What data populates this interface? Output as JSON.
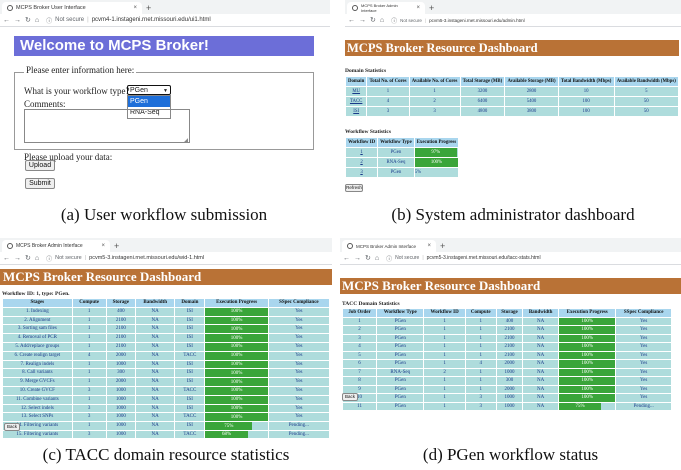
{
  "panel_a": {
    "tab_title": "MCPS Broker User Interface",
    "not_secure": "Not secure",
    "url": "pcvm4-1.instageni.rnet.missouri.edu/ui1.html",
    "heading": "Welcome to MCPS Broker!",
    "legend": "Please enter information here:",
    "workflow_label": "What is your workflow type?",
    "workflow_selected": "PGen",
    "workflow_options": [
      "PGen",
      "RNA-Seq"
    ],
    "comments_label": "Comments:",
    "upload_label": "Please upload your data:",
    "upload_button": "Upload",
    "submit_button": "Submit",
    "caption": "(a) User workflow submission"
  },
  "panel_b": {
    "tab_title": "MCPS Broker Admin Interface",
    "not_secure": "Not secure",
    "url": "pcvm5-3.instageni.rnet.missouri.edu/admin.html",
    "heading": "MCPS Broker Resource Dashboard",
    "domain_title": "Domain Statistics",
    "domain_headers": [
      "Domain",
      "Total No. of Cores",
      "Available No. of Cores",
      "Total Storage (MB)",
      "Available Storage (MB)",
      "Total Bandwidth (Mbps)",
      "Available Bandwidth (Mbps)"
    ],
    "domain_rows": [
      [
        "MU",
        "1",
        "1",
        "3200",
        "2800",
        "10",
        "5"
      ],
      [
        "TACC",
        "4",
        "2",
        "6400",
        "5400",
        "100",
        "50"
      ],
      [
        "ISI",
        "3",
        "3",
        "4800",
        "3800",
        "100",
        "50"
      ]
    ],
    "workflow_title": "Workflow Statistics",
    "workflow_headers": [
      "Workflow ID",
      "Workflow Type",
      "Execution Progress"
    ],
    "workflow_rows": [
      {
        "id": "1",
        "type": "PGen",
        "progress_text": "97%",
        "progress": 0.97
      },
      {
        "id": "2",
        "type": "RNA-Seq",
        "progress_text": "100%",
        "progress": 1.0
      },
      {
        "id": "3",
        "type": "PGen",
        "progress_text": "5%",
        "progress": 0.05
      }
    ],
    "refresh_button": "Refresh",
    "caption": "(b) System administrator dashboard"
  },
  "panel_c": {
    "tab_title": "MCPS Broker Admin Interface",
    "not_secure": "Not secure",
    "url": "pcvm5-3.instageni.rnet.missouri.edu/wid-1.html",
    "heading": "MCPS Broker Resource Dashboard",
    "subtitle": "Workflow ID: 1, type: PGen.",
    "headers": [
      "Stages",
      "Compute",
      "Storage",
      "Bandwidth",
      "Domain",
      "Execution Progress",
      "SSpec Compliance"
    ],
    "rows": [
      {
        "stage": "1. Indexing",
        "compute": "1",
        "storage": "400",
        "bandwidth": "NA",
        "domain": "ISI",
        "progress_text": "100%",
        "progress": 1.0,
        "compliance": "Yes"
      },
      {
        "stage": "2. Alignment",
        "compute": "1",
        "storage": "2100",
        "bandwidth": "NA",
        "domain": "ISI",
        "progress_text": "100%",
        "progress": 1.0,
        "compliance": "Yes"
      },
      {
        "stage": "3. Sorting sam files",
        "compute": "1",
        "storage": "2100",
        "bandwidth": "NA",
        "domain": "ISI",
        "progress_text": "100%",
        "progress": 1.0,
        "compliance": "Yes"
      },
      {
        "stage": "4. Removal of PCR",
        "compute": "1",
        "storage": "2100",
        "bandwidth": "NA",
        "domain": "ISI",
        "progress_text": "100%",
        "progress": 1.0,
        "compliance": "Yes"
      },
      {
        "stage": "5. Add/replace groups",
        "compute": "1",
        "storage": "2100",
        "bandwidth": "NA",
        "domain": "ISI",
        "progress_text": "100%",
        "progress": 1.0,
        "compliance": "Yes"
      },
      {
        "stage": "6. Create realign target",
        "compute": "4",
        "storage": "2000",
        "bandwidth": "NA",
        "domain": "TACC",
        "progress_text": "100%",
        "progress": 1.0,
        "compliance": "Yes"
      },
      {
        "stage": "7. Realign indels",
        "compute": "1",
        "storage": "1000",
        "bandwidth": "NA",
        "domain": "ISI",
        "progress_text": "100%",
        "progress": 1.0,
        "compliance": "Yes"
      },
      {
        "stage": "8. Call variants",
        "compute": "1",
        "storage": "300",
        "bandwidth": "NA",
        "domain": "ISI",
        "progress_text": "100%",
        "progress": 1.0,
        "compliance": "Yes"
      },
      {
        "stage": "9. Merge GVCFs",
        "compute": "1",
        "storage": "2000",
        "bandwidth": "NA",
        "domain": "ISI",
        "progress_text": "100%",
        "progress": 1.0,
        "compliance": "Yes"
      },
      {
        "stage": "10. Create GVCF",
        "compute": "3",
        "storage": "1000",
        "bandwidth": "NA",
        "domain": "TACC",
        "progress_text": "100%",
        "progress": 1.0,
        "compliance": "Yes"
      },
      {
        "stage": "11. Combine variants",
        "compute": "1",
        "storage": "1000",
        "bandwidth": "NA",
        "domain": "ISI",
        "progress_text": "100%",
        "progress": 1.0,
        "compliance": "Yes"
      },
      {
        "stage": "12. Select indels",
        "compute": "3",
        "storage": "1000",
        "bandwidth": "NA",
        "domain": "ISI",
        "progress_text": "100%",
        "progress": 1.0,
        "compliance": "Yes"
      },
      {
        "stage": "13. Select SNPs",
        "compute": "3",
        "storage": "1000",
        "bandwidth": "NA",
        "domain": "TACC",
        "progress_text": "100%",
        "progress": 1.0,
        "compliance": "Yes"
      },
      {
        "stage": "14. Filtering variants",
        "compute": "1",
        "storage": "1000",
        "bandwidth": "NA",
        "domain": "ISI",
        "progress_text": "75%",
        "progress": 0.75,
        "compliance": "Pending..."
      },
      {
        "stage": "15. Filtering variants",
        "compute": "3",
        "storage": "1000",
        "bandwidth": "NA",
        "domain": "TACC",
        "progress_text": "68%",
        "progress": 0.68,
        "compliance": "Pending..."
      }
    ],
    "back_button": "Back",
    "caption": "(c) TACC domain resource statistics"
  },
  "panel_d": {
    "tab_title": "MCPS Broker Admin Interface",
    "not_secure": "Not secure",
    "url": "pcvm5-3.instageni.rnet.missouri.edu/tacc-stats.html",
    "heading": "MCPS Broker Resource Dashboard",
    "subtitle": "TACC Domain Statistics",
    "headers": [
      "Job Order",
      "Workflow Type",
      "Workflow ID",
      "Compute",
      "Storage",
      "Bandwidth",
      "Execution Progress",
      "SSpec Compliance"
    ],
    "rows": [
      {
        "order": "1",
        "type": "PGen",
        "wid": "1",
        "compute": "1",
        "storage": "400",
        "bandwidth": "NA",
        "progress_text": "100%",
        "progress": 1.0,
        "compliance": "Yes"
      },
      {
        "order": "2",
        "type": "PGen",
        "wid": "1",
        "compute": "1",
        "storage": "2100",
        "bandwidth": "NA",
        "progress_text": "100%",
        "progress": 1.0,
        "compliance": "Yes"
      },
      {
        "order": "3",
        "type": "PGen",
        "wid": "1",
        "compute": "1",
        "storage": "2100",
        "bandwidth": "NA",
        "progress_text": "100%",
        "progress": 1.0,
        "compliance": "Yes"
      },
      {
        "order": "4",
        "type": "PGen",
        "wid": "1",
        "compute": "1",
        "storage": "2100",
        "bandwidth": "NA",
        "progress_text": "100%",
        "progress": 1.0,
        "compliance": "Yes"
      },
      {
        "order": "5",
        "type": "PGen",
        "wid": "1",
        "compute": "1",
        "storage": "2100",
        "bandwidth": "NA",
        "progress_text": "100%",
        "progress": 1.0,
        "compliance": "Yes"
      },
      {
        "order": "6",
        "type": "PGen",
        "wid": "1",
        "compute": "4",
        "storage": "2000",
        "bandwidth": "NA",
        "progress_text": "100%",
        "progress": 1.0,
        "compliance": "Yes"
      },
      {
        "order": "7",
        "type": "RNA-Seq",
        "wid": "2",
        "compute": "1",
        "storage": "1000",
        "bandwidth": "NA",
        "progress_text": "100%",
        "progress": 1.0,
        "compliance": "Yes"
      },
      {
        "order": "8",
        "type": "PGen",
        "wid": "1",
        "compute": "1",
        "storage": "300",
        "bandwidth": "NA",
        "progress_text": "100%",
        "progress": 1.0,
        "compliance": "Yes"
      },
      {
        "order": "9",
        "type": "PGen",
        "wid": "1",
        "compute": "1",
        "storage": "2000",
        "bandwidth": "NA",
        "progress_text": "100%",
        "progress": 1.0,
        "compliance": "Yes"
      },
      {
        "order": "10",
        "type": "PGen",
        "wid": "1",
        "compute": "3",
        "storage": "1000",
        "bandwidth": "NA",
        "progress_text": "100%",
        "progress": 1.0,
        "compliance": "Yes"
      },
      {
        "order": "11",
        "type": "PGen",
        "wid": "1",
        "compute": "3",
        "storage": "1000",
        "bandwidth": "NA",
        "progress_text": "75%",
        "progress": 0.75,
        "compliance": "Pending..."
      }
    ],
    "back_button": "Back",
    "caption": "(d) PGen workflow status"
  },
  "colors": {
    "welcome_banner": "#6c6ed8",
    "dashboard_banner": "#b97236",
    "table_header": "#a9d6ee",
    "table_cell": "#aedcdc",
    "progress_fill": "#3aa53a",
    "select_highlight": "#1e6fd9"
  },
  "icons": [
    "back-arrow-icon",
    "forward-arrow-icon",
    "reload-icon",
    "home-icon",
    "info-icon",
    "close-icon",
    "new-tab-icon",
    "dropdown-arrow-icon"
  ]
}
